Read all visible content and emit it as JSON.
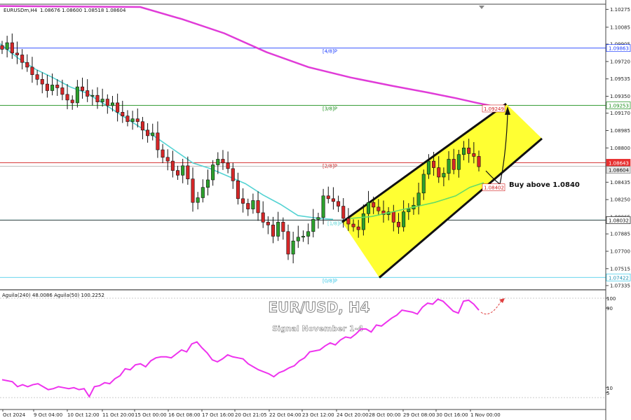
{
  "header": {
    "instrument": "EURUSDm,H4",
    "ohlc": "1.08676 1.08600 1.08518 1.08604"
  },
  "indicator_header": "Aguila(240) 48.0086  Aguila(50) 100.2252",
  "overlay": {
    "title": "EUR/USD, H4",
    "subtitle": "Signal November 1-4",
    "callout": "Buy above 1.0840"
  },
  "colors": {
    "bull": "#2ca02c",
    "bear": "#d62728",
    "ma_long": "#e03cd8",
    "ma_short": "#55d3d3",
    "ma_mid": "#66dd66",
    "channel": "#ffff33",
    "murrey_48": "#1f3fff",
    "murrey_38": "#1b8f1b",
    "murrey_28": "#d21e1e",
    "murrey_08": "#34c6e6",
    "oscillator": "#ee33ee"
  },
  "chart_data": {
    "type": "candlestick",
    "symbol": "EURUSDm",
    "timeframe": "H4",
    "ylim": [
      1.0729,
      1.1033
    ],
    "y_ticks": [
      1.10275,
      1.10085,
      1.09905,
      1.0972,
      1.09535,
      1.0935,
      1.0917,
      1.08985,
      1.088,
      1.08615,
      1.08435,
      1.0825,
      1.08065,
      1.07885,
      1.077,
      1.07515,
      1.07335
    ],
    "y_tick_labels": [
      "1.10275",
      "1.10085",
      "1.09905",
      "1.09720",
      "1.09535",
      "1.09350",
      "1.09170",
      "1.08985",
      "1.08800",
      "1.08615",
      "1.08435",
      "1.08250",
      "1.08065",
      "1.07885",
      "1.07700",
      "1.07515",
      "1.07335"
    ],
    "x_labels": [
      "Oct 2024",
      "9 Oct 04:00",
      "10 Oct 12:00",
      "11 Oct 20:00",
      "15 Oct 00:00",
      "16 Oct 08:00",
      "17 Oct 16:00",
      "20 Oct 21:05",
      "22 Oct 04:00",
      "23 Oct 12:00",
      "24 Oct 20:00",
      "28 Oct 00:00",
      "29 Oct 08:00",
      "30 Oct 16:00",
      "1 Nov 00:00"
    ],
    "close_series": [
      1.0985,
      1.0992,
      1.0981,
      1.0979,
      1.0971,
      1.0966,
      1.0958,
      1.0953,
      1.0948,
      1.0941,
      1.0947,
      1.0944,
      1.0937,
      1.0931,
      1.0928,
      1.0945,
      1.0941,
      1.0935,
      1.0936,
      1.0929,
      1.0932,
      1.0925,
      1.0928,
      1.0918,
      1.0914,
      1.0908,
      1.0911,
      1.0908,
      1.0899,
      1.0893,
      1.0896,
      1.0878,
      1.087,
      1.0866,
      1.0856,
      1.0851,
      1.0861,
      1.0847,
      1.0822,
      1.0827,
      1.0838,
      1.0846,
      1.0862,
      1.0868,
      1.0864,
      1.0858,
      1.0845,
      1.0826,
      1.0821,
      1.0815,
      1.0824,
      1.0811,
      1.0801,
      1.0798,
      1.0786,
      1.0801,
      1.0791,
      1.0767,
      1.0781,
      1.0785,
      1.0786,
      1.0791,
      1.0804,
      1.0806,
      1.0829,
      1.0826,
      1.0823,
      1.0818,
      1.0805,
      1.0799,
      1.0796,
      1.0793,
      1.081,
      1.0822,
      1.0817,
      1.0813,
      1.0809,
      1.0812,
      1.0801,
      1.0796,
      1.0812,
      1.0815,
      1.0819,
      1.0832,
      1.0852,
      1.0866,
      1.0859,
      1.0849,
      1.0853,
      1.0868,
      1.0857,
      1.0873,
      1.088,
      1.0874,
      1.0871,
      1.086
    ],
    "moving_averages": [
      {
        "key": "ma_long",
        "points": [
          [
            1.1031,
            1.103
          ],
          [
            1.1017,
            1.1002,
            1.0982,
            1.0966,
            1.0955,
            1.0946,
            1.0939,
            1.0933,
            1.0928,
            1.0925
          ]
        ]
      },
      {
        "key": "ma_short",
        "points": [
          1.0991,
          1.0976,
          1.0964,
          1.0955,
          1.0945,
          1.0938,
          1.0926,
          1.0914,
          1.0902,
          1.089,
          1.0877,
          1.0864,
          1.0858,
          1.085,
          1.0842,
          1.083,
          1.082,
          1.0808,
          1.0805,
          1.0804
        ]
      },
      {
        "key": "ma_mid",
        "points": [
          1.0805,
          1.0807,
          1.0812,
          1.0817,
          1.0822,
          1.0829,
          1.0838,
          1.0843
        ]
      }
    ],
    "levels": [
      {
        "label": "[4/8]P",
        "value": 1.09863,
        "color_key": "murrey_48"
      },
      {
        "label": "[3/8]P",
        "value": 1.09253,
        "color_key": "murrey_38"
      },
      {
        "label": "[2/8]P",
        "value": 1.08643,
        "color_key": "murrey_28"
      },
      {
        "label": "[1/8]P",
        "value": 1.08032,
        "color_key": "ma_short"
      },
      {
        "label": "[0/8]P",
        "value": 1.07422,
        "color_key": "murrey_08"
      }
    ],
    "price_tags": [
      {
        "text": "1.09863",
        "value": 1.09863,
        "style": "blue"
      },
      {
        "text": "1.09253",
        "value": 1.09253,
        "style": "green"
      },
      {
        "text": "1.08643",
        "value": 1.08643,
        "style": "red"
      },
      {
        "text": "1.08604",
        "value": 1.08604,
        "style": "grey"
      },
      {
        "text": "1.08032",
        "value": 1.08032,
        "style": "dark"
      },
      {
        "text": "1.07422",
        "value": 1.07422,
        "style": "cyan"
      }
    ],
    "inner_tags": [
      {
        "text": "1.09249",
        "value": 1.0922
      },
      {
        "text": "1.08402",
        "value": 1.0838
      }
    ],
    "channel": {
      "upper": [
        1.0801,
        1.0927
      ],
      "lower": [
        1.0742,
        1.089
      ]
    },
    "oscillator": {
      "label": "Aguila",
      "axis_ticks": [
        100,
        90,
        10,
        5
      ],
      "values": [
        18,
        17,
        16,
        11,
        13,
        11,
        13,
        14,
        11,
        8,
        9,
        11,
        10,
        9,
        10,
        8,
        9,
        1,
        11,
        12,
        15,
        14,
        19,
        22,
        29,
        28,
        33,
        34,
        31,
        37,
        40,
        41,
        41,
        40,
        44,
        48,
        46,
        54,
        56,
        50,
        45,
        38,
        36,
        39,
        43,
        41,
        40,
        39,
        34,
        31,
        28,
        26,
        24,
        21,
        25,
        27,
        30,
        32,
        37,
        40,
        46,
        47,
        48,
        52,
        55,
        53,
        58,
        61,
        60,
        64,
        69,
        69,
        66,
        73,
        72,
        76,
        80,
        83,
        88,
        87,
        86,
        84,
        91,
        95,
        94,
        99,
        97,
        92,
        87,
        85,
        97,
        98,
        94,
        88
      ]
    }
  }
}
